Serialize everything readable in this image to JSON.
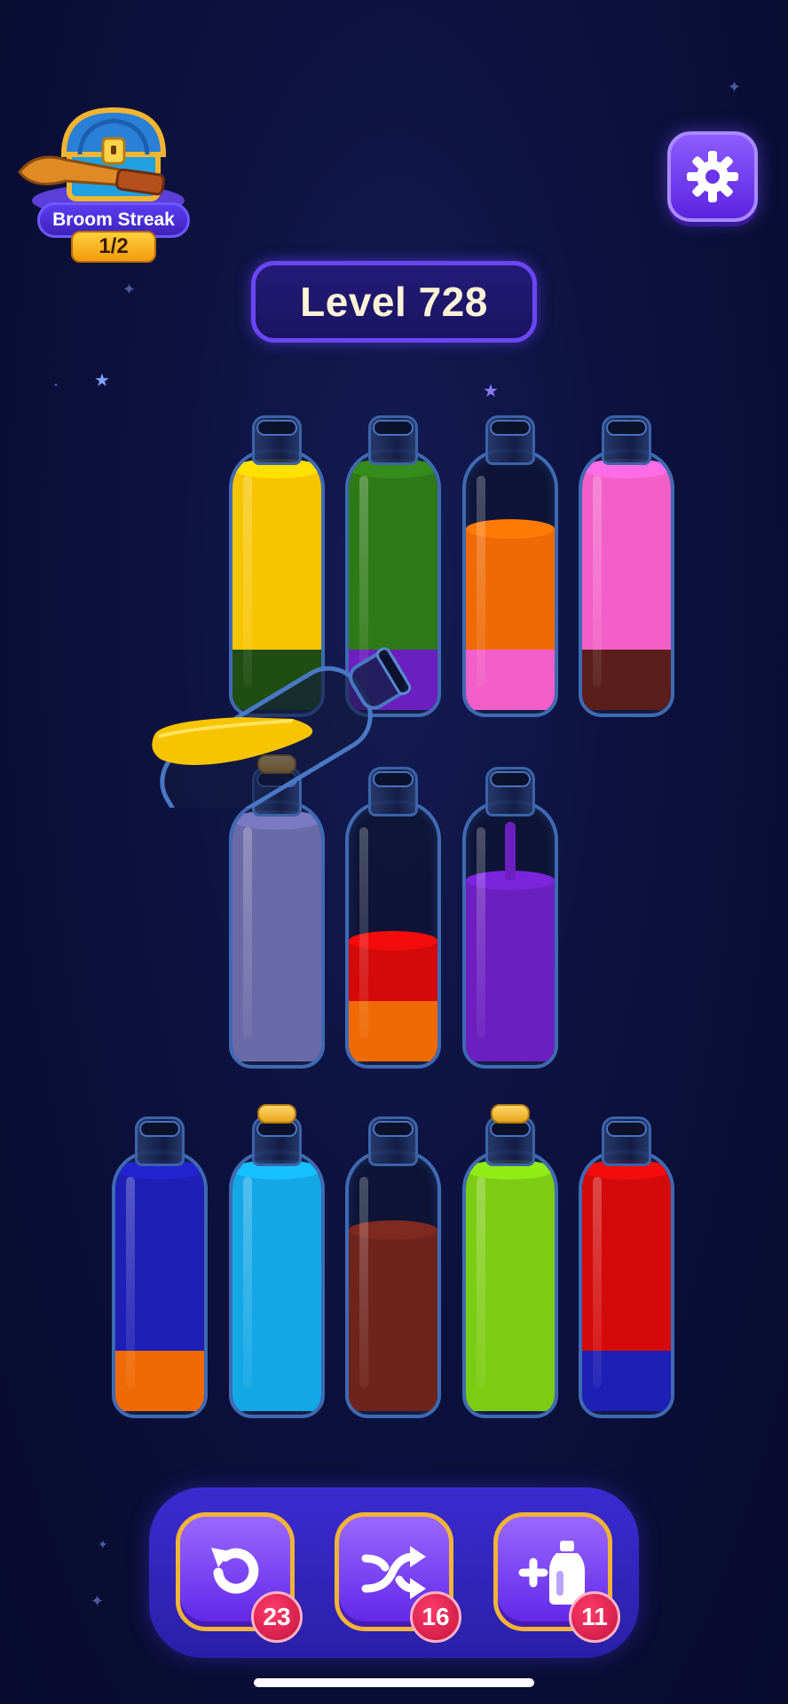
{
  "streak": {
    "label": "Broom Streak",
    "count": "1/2",
    "icon": "treasure-chest-broom-icon"
  },
  "settings": {
    "icon": "gear-icon"
  },
  "level": {
    "label": "Level 728"
  },
  "colors": {
    "yellow": "#f7c400",
    "dark_green": "#1f4d12",
    "green": "#2e7a18",
    "purple": "#6b1fbf",
    "orange": "#ef6a05",
    "pink": "#f25fc8",
    "maroon": "#5a1f1a",
    "lavender": "#6b6aa8",
    "red": "#d40a0a",
    "blue": "#1d1fb5",
    "cyan": "#14a7e6",
    "brown": "#6e241c",
    "lime": "#7dcc14"
  },
  "bottles": [
    {
      "id": "row1-1",
      "layers_bottom_up": [
        {
          "color": "dark_green",
          "units": 1
        },
        {
          "color": "yellow",
          "units": 3
        }
      ],
      "corked": false
    },
    {
      "id": "row1-2",
      "layers_bottom_up": [
        {
          "color": "purple",
          "units": 1
        },
        {
          "color": "green",
          "units": 3
        }
      ],
      "corked": false
    },
    {
      "id": "row1-3",
      "layers_bottom_up": [
        {
          "color": "pink",
          "units": 1
        },
        {
          "color": "orange",
          "units": 2
        }
      ],
      "corked": false
    },
    {
      "id": "row1-4",
      "layers_bottom_up": [
        {
          "color": "maroon",
          "units": 1
        },
        {
          "color": "pink",
          "units": 3
        }
      ],
      "corked": false
    },
    {
      "id": "row2-1",
      "layers_bottom_up": [
        {
          "color": "lavender",
          "units": 4
        }
      ],
      "corked": true
    },
    {
      "id": "row2-2",
      "layers_bottom_up": [
        {
          "color": "orange",
          "units": 1
        },
        {
          "color": "red",
          "units": 1
        }
      ],
      "corked": false
    },
    {
      "id": "row2-3",
      "layers_bottom_up": [
        {
          "color": "purple",
          "units": 3
        }
      ],
      "corked": false
    },
    {
      "id": "row3-1",
      "layers_bottom_up": [
        {
          "color": "orange",
          "units": 1
        },
        {
          "color": "blue",
          "units": 3
        }
      ],
      "corked": false
    },
    {
      "id": "row3-2",
      "layers_bottom_up": [
        {
          "color": "cyan",
          "units": 4
        }
      ],
      "corked": true
    },
    {
      "id": "row3-3",
      "layers_bottom_up": [
        {
          "color": "brown",
          "units": 3
        }
      ],
      "corked": false
    },
    {
      "id": "row3-4",
      "layers_bottom_up": [
        {
          "color": "lime",
          "units": 4
        }
      ],
      "corked": true
    },
    {
      "id": "row3-5",
      "layers_bottom_up": [
        {
          "color": "blue",
          "units": 1
        },
        {
          "color": "red",
          "units": 3
        }
      ],
      "corked": false
    }
  ],
  "pouring_bottle": {
    "color": "yellow",
    "units": 1
  },
  "tools": [
    {
      "name": "undo",
      "icon": "undo-icon",
      "count": "23"
    },
    {
      "name": "shuffle",
      "icon": "shuffle-icon",
      "count": "16"
    },
    {
      "name": "add-bottle",
      "icon": "add-bottle-icon",
      "count": "11"
    }
  ]
}
